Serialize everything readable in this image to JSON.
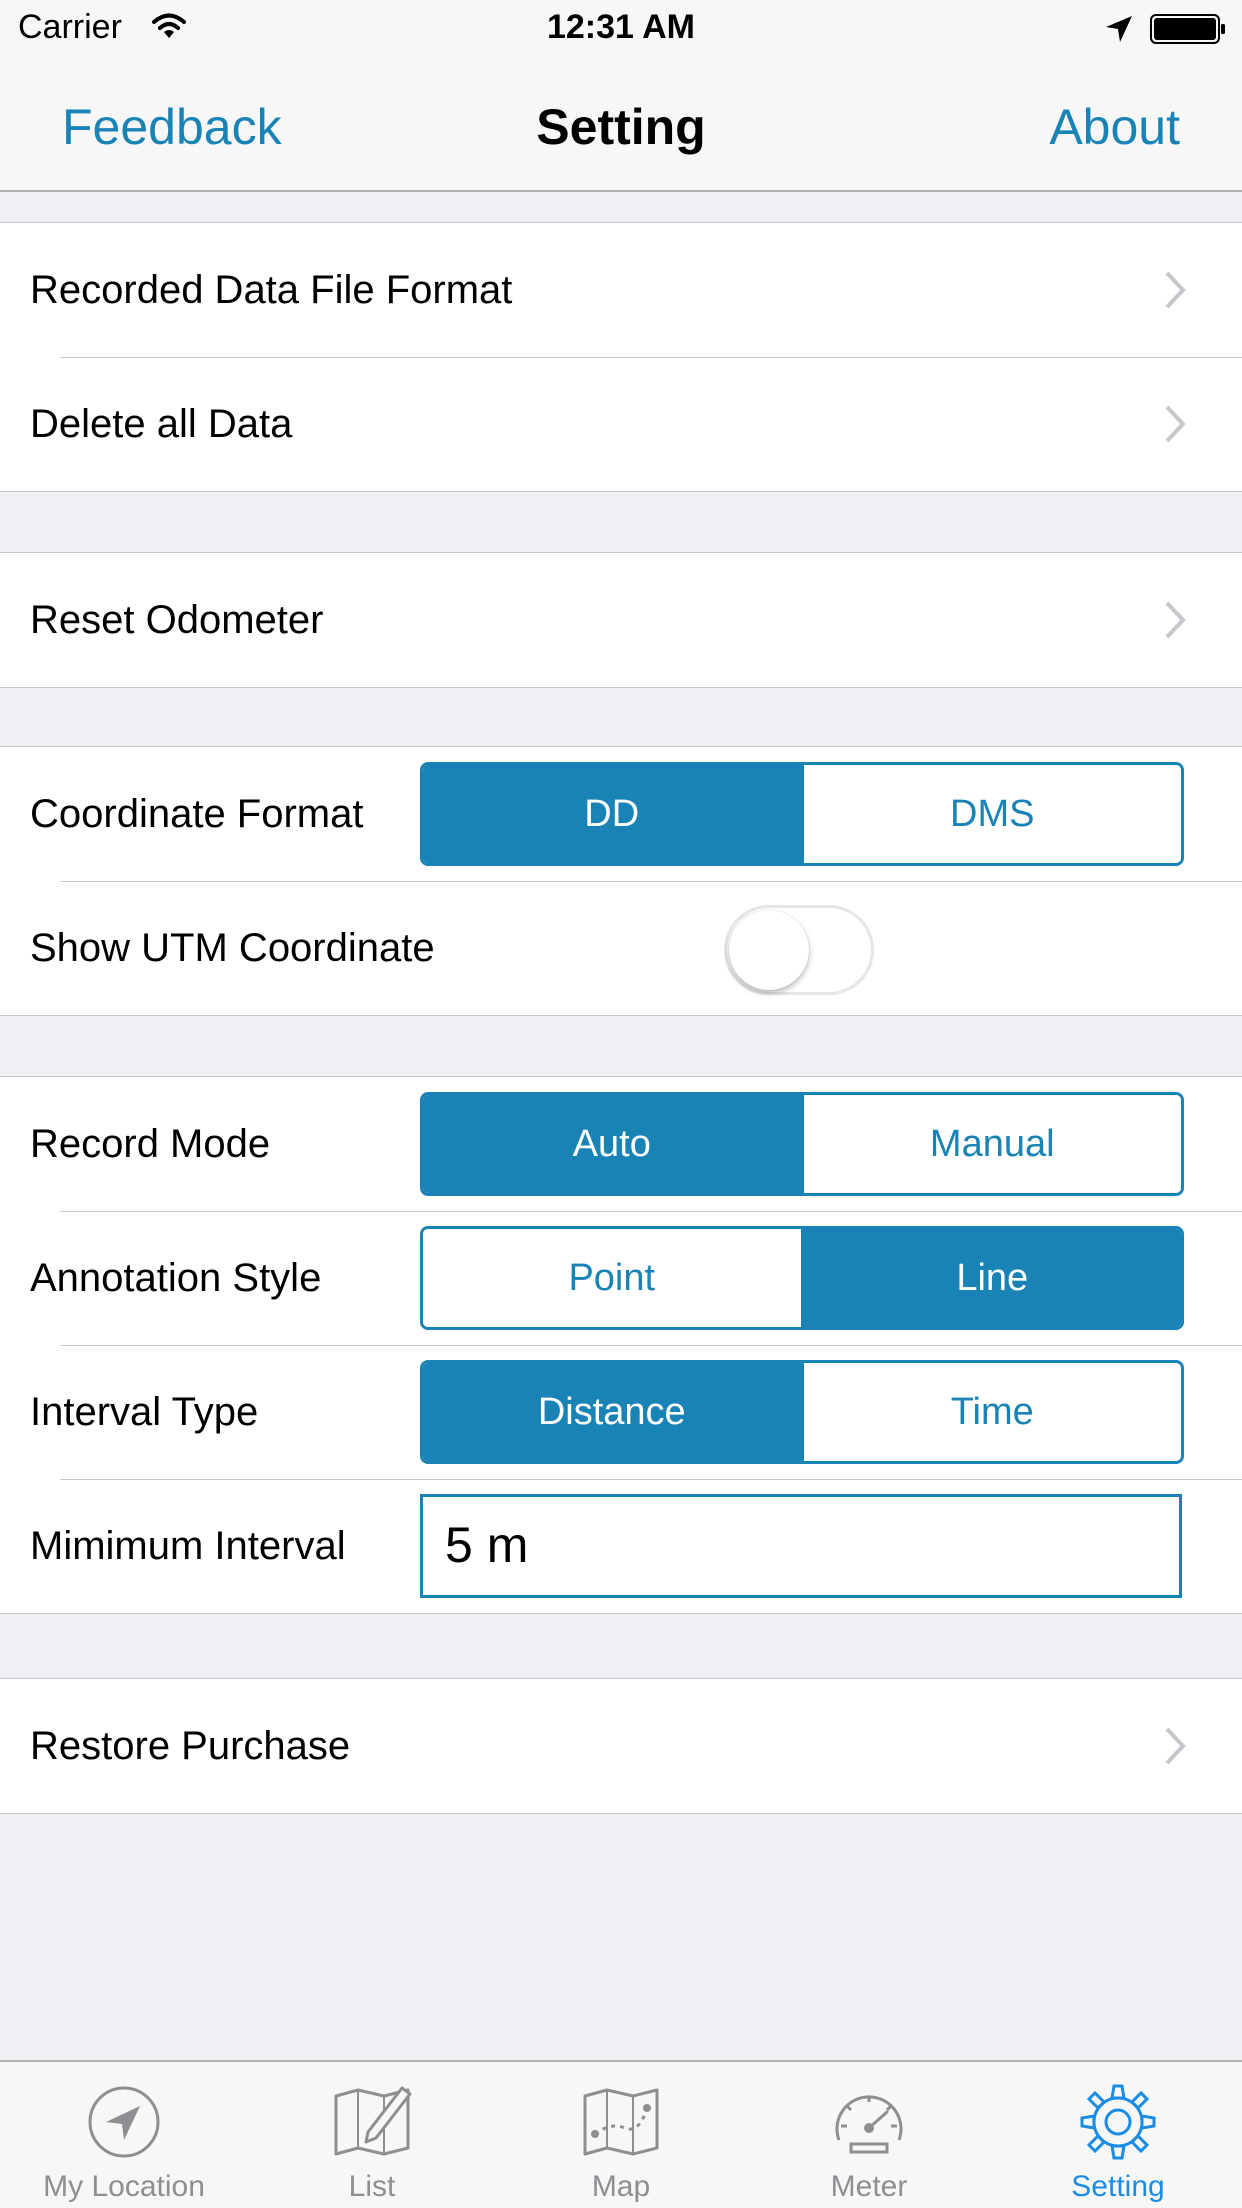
{
  "status_bar": {
    "carrier": "Carrier",
    "time": "12:31 AM",
    "icons": [
      "wifi-icon",
      "location-arrow-icon",
      "battery-icon"
    ]
  },
  "nav": {
    "left_button": "Feedback",
    "title": "Setting",
    "right_button": "About"
  },
  "sections": {
    "data": {
      "recorded_format": "Recorded Data File Format",
      "delete_all": "Delete all Data"
    },
    "odometer": {
      "reset": "Reset Odometer"
    },
    "coordinates": {
      "format_label": "Coordinate Format",
      "format_options": [
        "DD",
        "DMS"
      ],
      "format_selected": "DD",
      "utm_label": "Show UTM Coordinate",
      "utm_enabled": false
    },
    "recording": {
      "mode_label": "Record Mode",
      "mode_options": [
        "Auto",
        "Manual"
      ],
      "mode_selected": "Auto",
      "annotation_label": "Annotation Style",
      "annotation_options": [
        "Point",
        "Line"
      ],
      "annotation_selected": "Line",
      "interval_type_label": "Interval Type",
      "interval_type_options": [
        "Distance",
        "Time"
      ],
      "interval_type_selected": "Distance",
      "min_interval_label": "Mimimum Interval",
      "min_interval_value": "5 m"
    },
    "purchase": {
      "restore": "Restore Purchase"
    }
  },
  "tabs": [
    {
      "label": "My Location",
      "icon": "location-arrow-circle-icon",
      "active": false
    },
    {
      "label": "List",
      "icon": "map-pencil-icon",
      "active": false
    },
    {
      "label": "Map",
      "icon": "map-route-icon",
      "active": false
    },
    {
      "label": "Meter",
      "icon": "speedometer-icon",
      "active": false
    },
    {
      "label": "Setting",
      "icon": "gear-icon",
      "active": true
    }
  ],
  "colors": {
    "accent": "#1a83b6",
    "tab_active": "#1a8ce6",
    "tab_inactive": "#8e8e93",
    "background": "#efeff4"
  }
}
